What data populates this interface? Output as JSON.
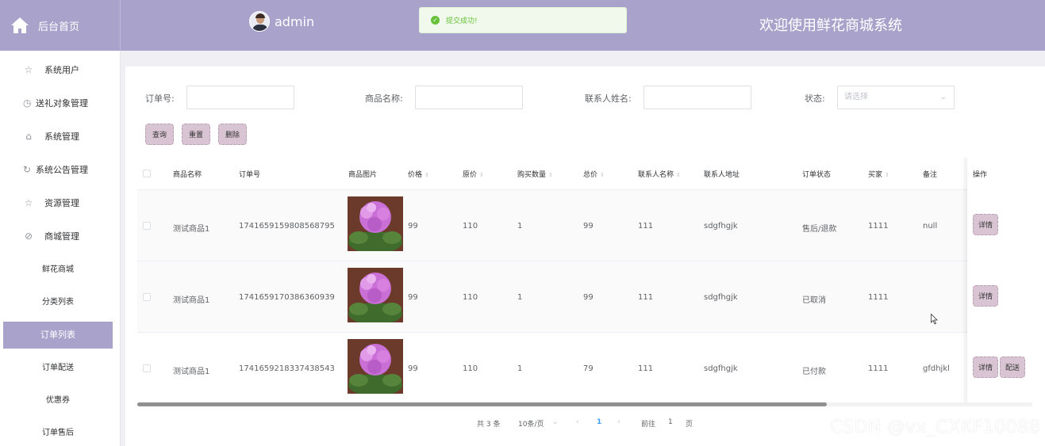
{
  "header": {
    "brand_label": "后台首页",
    "username": "admin",
    "site_title": "欢迎使用鲜花商城系统",
    "toast": "提交成功!",
    "accent": "#a9a3cc"
  },
  "sidebar": {
    "items": [
      {
        "label": "系统用户",
        "icon": "star-icon"
      },
      {
        "label": "送礼对象管理",
        "icon": "clock-icon"
      },
      {
        "label": "系统管理",
        "icon": "shopping-bag-icon"
      },
      {
        "label": "系统公告管理",
        "icon": "refresh-icon"
      },
      {
        "label": "资源管理",
        "icon": "star-icon"
      },
      {
        "label": "商城管理",
        "icon": "compass-icon"
      }
    ],
    "subitems": [
      "鲜花商城",
      "分类列表",
      "订单列表",
      "订单配送",
      "优惠券",
      "订单售后"
    ],
    "active_subitem": "订单列表"
  },
  "search": {
    "order_no_label": "订单号:",
    "goods_name_label": "商品名称:",
    "contact_name_label": "联系人姓名:",
    "status_label": "状态:",
    "status_placeholder": "请选择"
  },
  "buttons": {
    "query": "查询",
    "reset": "重置",
    "delete": "删除"
  },
  "table": {
    "headers": [
      "商品名称",
      "订单号",
      "商品图片",
      "价格",
      "原价",
      "购买数量",
      "总价",
      "联系人名称",
      "联系人地址",
      "订单状态",
      "买家",
      "备注",
      "操作"
    ],
    "rows": [
      {
        "goods": "测试商品1",
        "order_no": "1741659159808568795",
        "price": "99",
        "original": "110",
        "qty": "1",
        "total": "99",
        "contact": "111",
        "address": "sdgfhgjk",
        "status": "售后/退款",
        "buyer": "1111",
        "remark": "null"
      },
      {
        "goods": "测试商品1",
        "order_no": "1741659170386360939",
        "price": "99",
        "original": "110",
        "qty": "1",
        "total": "99",
        "contact": "111",
        "address": "sdgfhgjk",
        "status": "已取消",
        "buyer": "1111",
        "remark": ""
      },
      {
        "goods": "测试商品1",
        "order_no": "1741659218337438543",
        "price": "99",
        "original": "110",
        "qty": "1",
        "total": "79",
        "contact": "111",
        "address": "sdgfhgjk",
        "status": "已付款",
        "buyer": "1111",
        "remark": "gfdhjkl"
      }
    ],
    "detail_label": "详情",
    "deliver_label": "配送"
  },
  "pager": {
    "total": "共 3 条",
    "page_size": "10条/页",
    "current": "1",
    "goto": "前往",
    "goto_value": "1",
    "page_unit": "页"
  },
  "watermark": "CSDN @vx_CXKF10088"
}
